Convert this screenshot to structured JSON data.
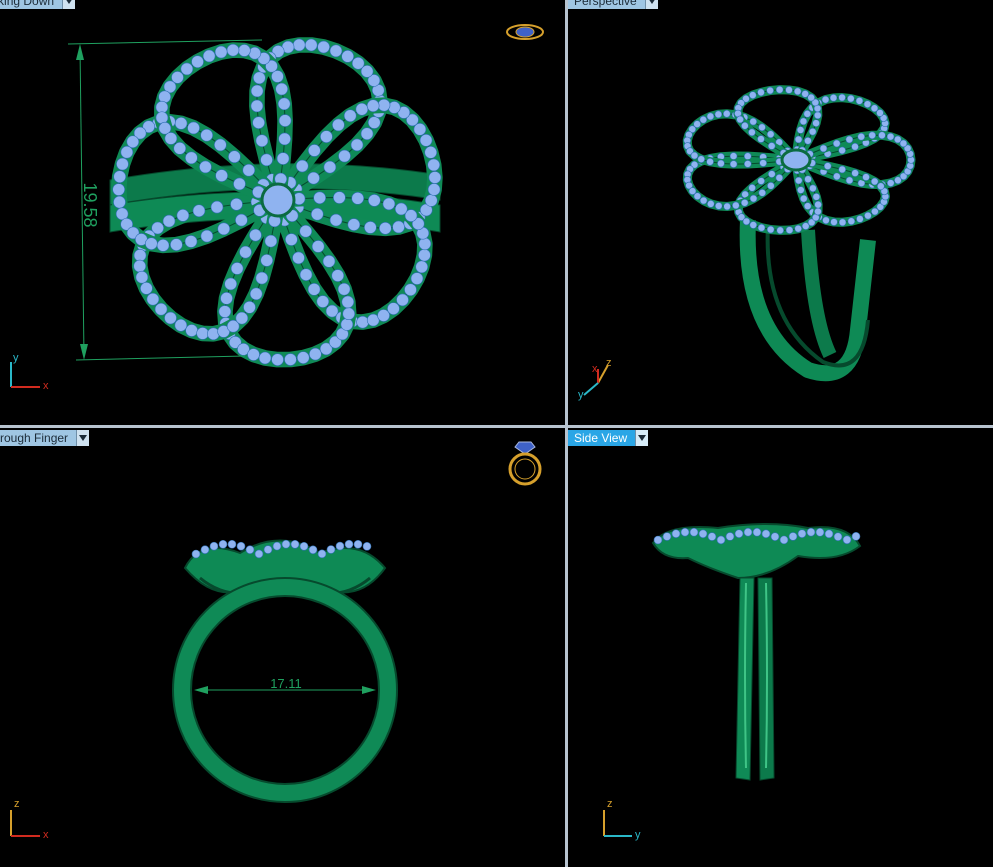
{
  "viewports": {
    "top_left": {
      "title": "Looking Down",
      "dimension": "19.58",
      "axes": [
        "y",
        "x"
      ]
    },
    "top_right": {
      "title": "Perspective",
      "axes": [
        "z",
        "x",
        "y"
      ]
    },
    "bottom_left": {
      "title": "Through Finger",
      "dimension": "17.11",
      "axes": [
        "z",
        "x"
      ]
    },
    "bottom_right": {
      "title": "Side View",
      "axes": [
        "z",
        "y"
      ]
    }
  },
  "colors": {
    "metal": "#0f8a56",
    "metal_dark": "#064a2d",
    "gem": "#8fb3f0",
    "active_tab": "#2aa6e6",
    "tab": "#9fc6e3",
    "axis_x": "#d22b1f",
    "axis_y": "#2ab8c8",
    "axis_z": "#d6a02c",
    "dimension": "#1fa05f"
  },
  "icons": [
    "ring-top-icon",
    "ring-front-icon",
    "dropdown-arrow-icon"
  ]
}
